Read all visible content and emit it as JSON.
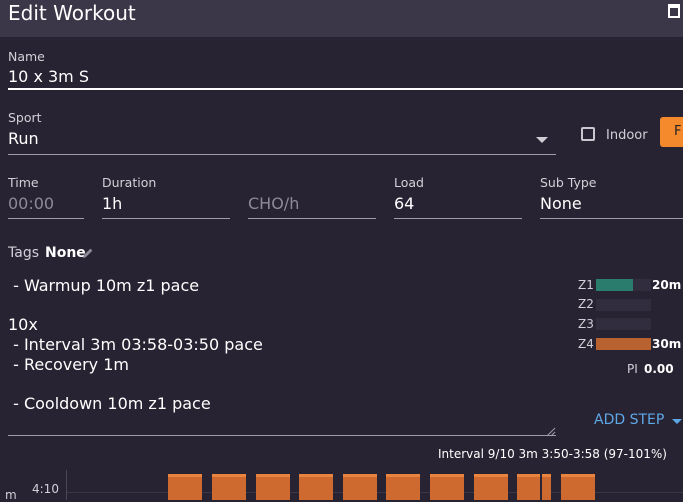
{
  "header": {
    "title": "Edit Workout"
  },
  "form": {
    "name": {
      "label": "Name",
      "value": "10 x 3m S"
    },
    "sport": {
      "label": "Sport",
      "value": "Run"
    },
    "indoor": {
      "label": "Indoor",
      "checked": false
    },
    "time": {
      "label": "Time",
      "placeholder": "00:00"
    },
    "duration": {
      "label": "Duration",
      "value": "1h"
    },
    "cho": {
      "placeholder": "CHO/h"
    },
    "load": {
      "label": "Load",
      "value": "64"
    },
    "subtype": {
      "label": "Sub Type",
      "value": "None"
    },
    "tags": {
      "label": "Tags",
      "value": "None"
    }
  },
  "description": {
    "lines": [
      " - Warmup 10m z1 pace",
      "",
      "10x",
      " - Interval 3m 03:58-03:50 pace",
      " - Recovery 1m",
      "",
      " - Cooldown 10m z1 pace"
    ]
  },
  "zones": [
    {
      "label": "Z1",
      "value": "20m",
      "fraction": 0.67,
      "color": "#2a7d6c"
    },
    {
      "label": "Z2",
      "value": "",
      "fraction": 0,
      "color": "#2a7d6c"
    },
    {
      "label": "Z3",
      "value": "",
      "fraction": 0,
      "color": "#2a7d6c"
    },
    {
      "label": "Z4",
      "value": "30m",
      "fraction": 1.0,
      "color": "#b9622f"
    }
  ],
  "pi": {
    "label": "PI",
    "value": "0.00"
  },
  "add_step_label": "ADD STEP",
  "interval_info": "Interval 9/10  3m  3:50-3:58 (97-101%)",
  "chart": {
    "y_tick": "4:10",
    "y_axis_label": "m",
    "bar_color": "#ce6a2f",
    "intervals_shown": 10
  }
}
